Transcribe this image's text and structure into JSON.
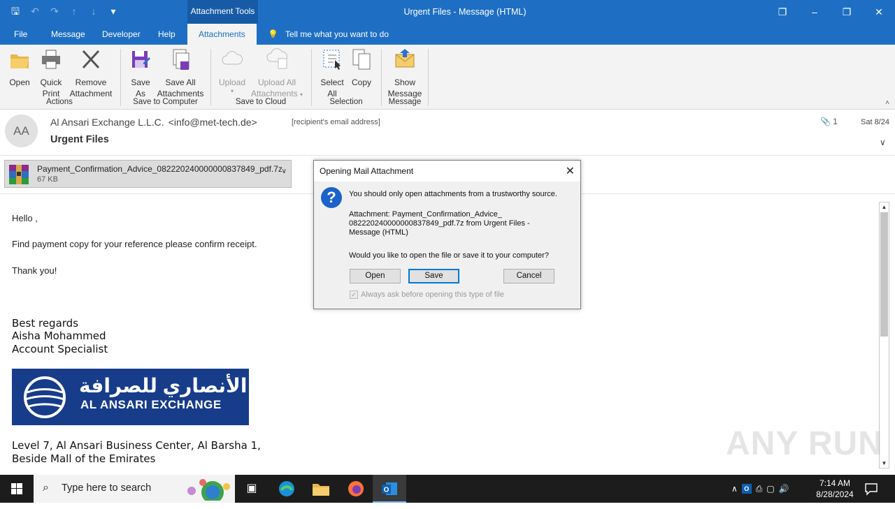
{
  "titlebar": {
    "context_tab": "Attachment Tools",
    "title": "Urgent Files  -  Message (HTML)"
  },
  "menu": {
    "file": "File",
    "message": "Message",
    "developer": "Developer",
    "help": "Help",
    "attachments": "Attachments",
    "tellme": "Tell me what you want to do"
  },
  "ribbon": {
    "open": "Open",
    "quick_print_1": "Quick",
    "quick_print_2": "Print",
    "remove_1": "Remove",
    "remove_2": "Attachment",
    "group_actions": "Actions",
    "save_as_1": "Save",
    "save_as_2": "As",
    "save_all_1": "Save All",
    "save_all_2": "Attachments",
    "group_save_computer": "Save to Computer",
    "upload": "Upload",
    "upload_all_1": "Upload All",
    "upload_all_2": "Attachments",
    "group_save_cloud": "Save to Cloud",
    "select_all_1": "Select",
    "select_all_2": "All",
    "copy": "Copy",
    "group_selection": "Selection",
    "show_message_1": "Show",
    "show_message_2": "Message",
    "group_message": "Message"
  },
  "header": {
    "avatar_initials": "AA",
    "sender_name": "Al Ansari Exchange L.L.C.",
    "sender_email": "<info@met-tech.de>",
    "recipient": "[recipient's email address]",
    "subject": "Urgent Files",
    "attachment_count": "1",
    "date": "Sat 8/24"
  },
  "attachment": {
    "name": "Payment_Confirmation_Advice_082220240000000837849_pdf.7z",
    "size": "67 KB"
  },
  "body": {
    "greeting": "Hello ,",
    "line1": "Find payment copy for your reference please confirm receipt.",
    "thanks": "Thank you!",
    "regards": "Best regards",
    "sig_name": "Aisha Mohammed",
    "sig_title": "Account Specialist",
    "logo_ar": "الأنصاري للصرافة",
    "logo_en": "AL ANSARI EXCHANGE",
    "addr1": "Level 7, Al Ansari Business Center, Al Barsha 1,",
    "addr2": "Beside Mall of the Emirates"
  },
  "watermark": "ANY RUN",
  "dialog": {
    "title": "Opening Mail Attachment",
    "warning": "You should only open attachments from a trustworthy source.",
    "attach_line1": "Attachment: Payment_Confirmation_Advice_",
    "attach_line2": "082220240000000837849_pdf.7z from Urgent Files -",
    "attach_line3": "Message (HTML)",
    "question": "Would you like to open the file or save it to your computer?",
    "open": "Open",
    "save": "Save",
    "cancel": "Cancel",
    "always_ask": "Always ask before opening this type of file"
  },
  "taskbar": {
    "search_placeholder": "Type here to search",
    "time": "7:14 AM",
    "date": "8/28/2024"
  }
}
